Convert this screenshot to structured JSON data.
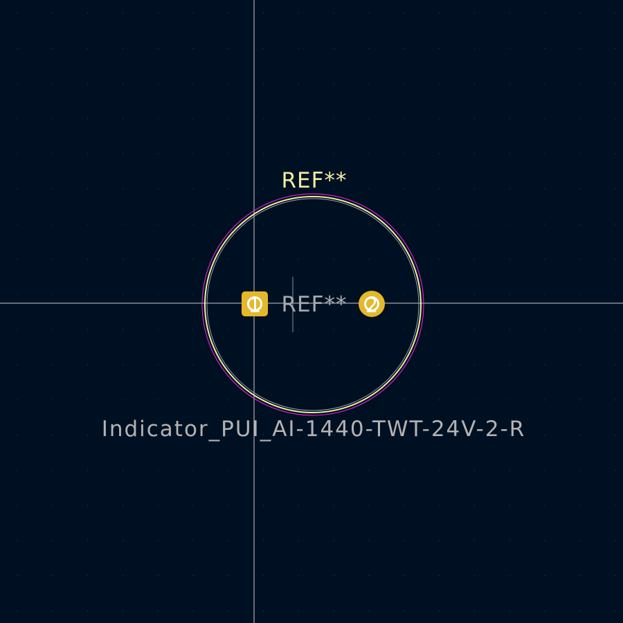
{
  "editor": {
    "view": "footprint-editor-canvas",
    "background_color": "#001023",
    "grid_dot_color": "#3a4658",
    "crosshair_color": "#c8ccd2"
  },
  "footprint": {
    "name": "Indicator_PUI_AI-1440-TWT-24V-2-R",
    "reference_silkscreen": "REF**",
    "reference_fab": "REF**",
    "pads": [
      {
        "number": "1",
        "shape": "rect"
      },
      {
        "number": "2",
        "shape": "circle"
      }
    ]
  },
  "colors": {
    "silkscreen": "#f2eda1",
    "fab": "#b0b0b0",
    "courtyard": "#ff26e2",
    "pad": "#e5b82c",
    "pad_number": "#ffffff",
    "value_text": "#b3b3b3"
  }
}
